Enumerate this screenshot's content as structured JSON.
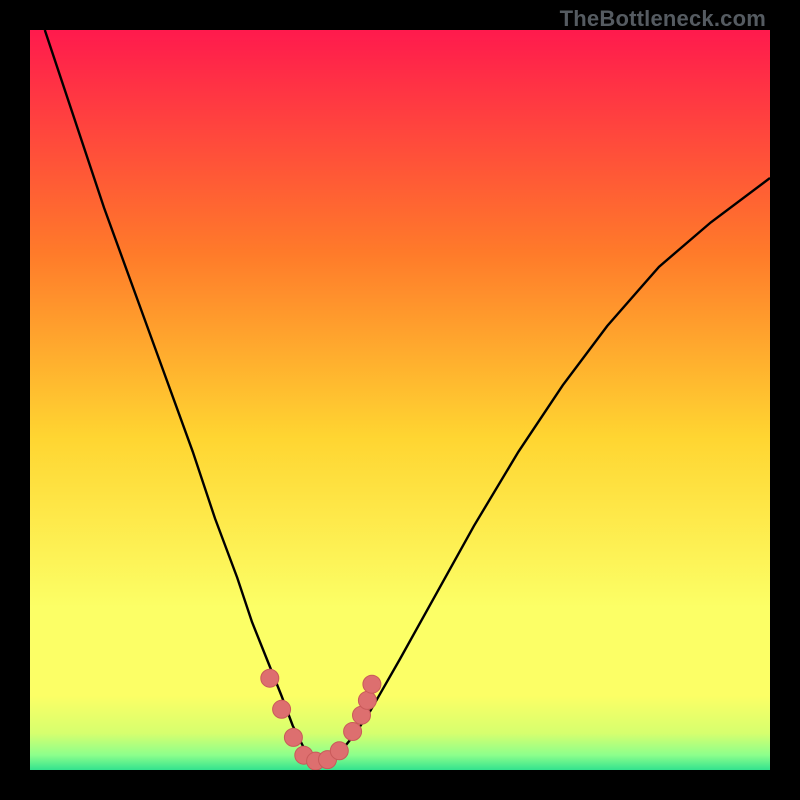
{
  "watermark": "TheBottleneck.com",
  "colors": {
    "black": "#000000",
    "gradient_top": "#ff1a4d",
    "gradient_upper_mid": "#ff7a2a",
    "gradient_mid": "#ffd531",
    "gradient_lower_mid": "#fcff66",
    "gradient_lower": "#d7ff6e",
    "gradient_green1": "#8cff8c",
    "gradient_green2": "#33e28e",
    "curve_stroke": "#000000",
    "marker_fill": "#dd6f6f",
    "marker_stroke": "#c95a5a"
  },
  "chart_data": {
    "type": "line",
    "title": "",
    "xlabel": "",
    "ylabel": "",
    "xlim": [
      0,
      100
    ],
    "ylim": [
      0,
      100
    ],
    "series": [
      {
        "name": "bottleneck-curve",
        "x": [
          2,
          6,
          10,
          14,
          18,
          22,
          25,
          28,
          30,
          32,
          34,
          35.5,
          37,
          38,
          39,
          40,
          42,
          44,
          46,
          50,
          55,
          60,
          66,
          72,
          78,
          85,
          92,
          100
        ],
        "y": [
          100,
          88,
          76,
          65,
          54,
          43,
          34,
          26,
          20,
          15,
          10,
          6,
          3,
          1.5,
          1,
          1.2,
          2.5,
          5,
          8,
          15,
          24,
          33,
          43,
          52,
          60,
          68,
          74,
          80
        ]
      }
    ],
    "markers": [
      {
        "x": 32.4,
        "y": 12.4
      },
      {
        "x": 34.0,
        "y": 8.2
      },
      {
        "x": 35.6,
        "y": 4.4
      },
      {
        "x": 37.0,
        "y": 2.0
      },
      {
        "x": 38.6,
        "y": 1.2
      },
      {
        "x": 40.2,
        "y": 1.4
      },
      {
        "x": 41.8,
        "y": 2.6
      },
      {
        "x": 43.6,
        "y": 5.2
      },
      {
        "x": 44.8,
        "y": 7.4
      },
      {
        "x": 45.6,
        "y": 9.4
      },
      {
        "x": 46.2,
        "y": 11.6
      }
    ]
  }
}
